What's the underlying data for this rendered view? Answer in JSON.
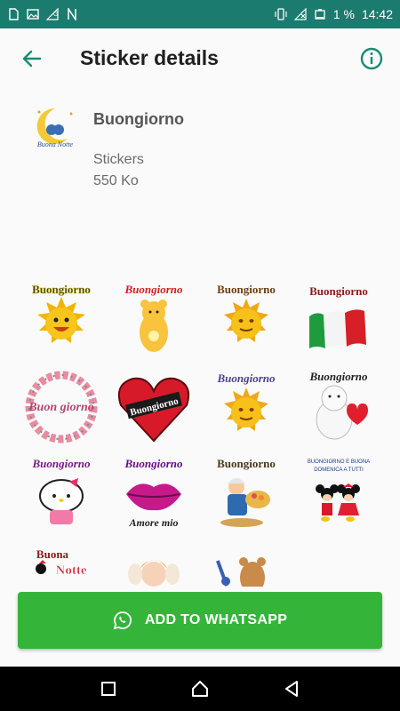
{
  "status_bar": {
    "battery": "1 %",
    "time": "14:42",
    "icons": [
      "sim-card-icon",
      "image-icon",
      "wifi-off-icon",
      "n-icon",
      "vibrate-icon",
      "no-signal-icon",
      "battery-low-icon"
    ]
  },
  "app_bar": {
    "title": "Sticker details",
    "back_icon": "arrow-back-icon",
    "info_icon": "info-icon"
  },
  "pack": {
    "name": "Buongiorno",
    "type": "Stickers",
    "size": "550 Ko",
    "thumb_text": "Buona Notte"
  },
  "stickers": [
    {
      "caption": "Buongiorno",
      "theme": "smiling-sun"
    },
    {
      "caption": "Buongiorno",
      "theme": "yellow-bear"
    },
    {
      "caption": "Buongiorno",
      "theme": "sun-emoji"
    },
    {
      "caption": "Buongiorno",
      "theme": "italian-flag"
    },
    {
      "caption": "Buon giorno",
      "theme": "flower-wreath"
    },
    {
      "caption": "Buongiorno",
      "theme": "red-heart"
    },
    {
      "caption": "Buongiorno",
      "theme": "sun-emoji"
    },
    {
      "caption": "Buongiorno",
      "theme": "white-bear-heart"
    },
    {
      "caption": "Buongiorno",
      "theme": "hello-kitty"
    },
    {
      "caption": "Buongiorno",
      "caption2": "Amore mio",
      "theme": "lips"
    },
    {
      "caption": "Buongiorno",
      "theme": "cartoon-chef"
    },
    {
      "caption": "BUONGIORNO E BUONA DOMENICA A TUTTI",
      "theme": "mickey-minnie"
    },
    {
      "caption": "Buona",
      "caption2": "Notte",
      "theme": "minnie"
    },
    {
      "caption": "",
      "theme": "angel"
    },
    {
      "caption": "",
      "theme": "teddy-bear"
    }
  ],
  "cta": {
    "label": "ADD TO WHATSAPP",
    "icon": "whatsapp-icon"
  },
  "nav_bar": {
    "icons": [
      "recent-apps-icon",
      "home-icon",
      "back-icon"
    ]
  },
  "colors": {
    "status_bar": "#1b7b6f",
    "accent": "#1b8a74",
    "cta": "#34b53a"
  }
}
